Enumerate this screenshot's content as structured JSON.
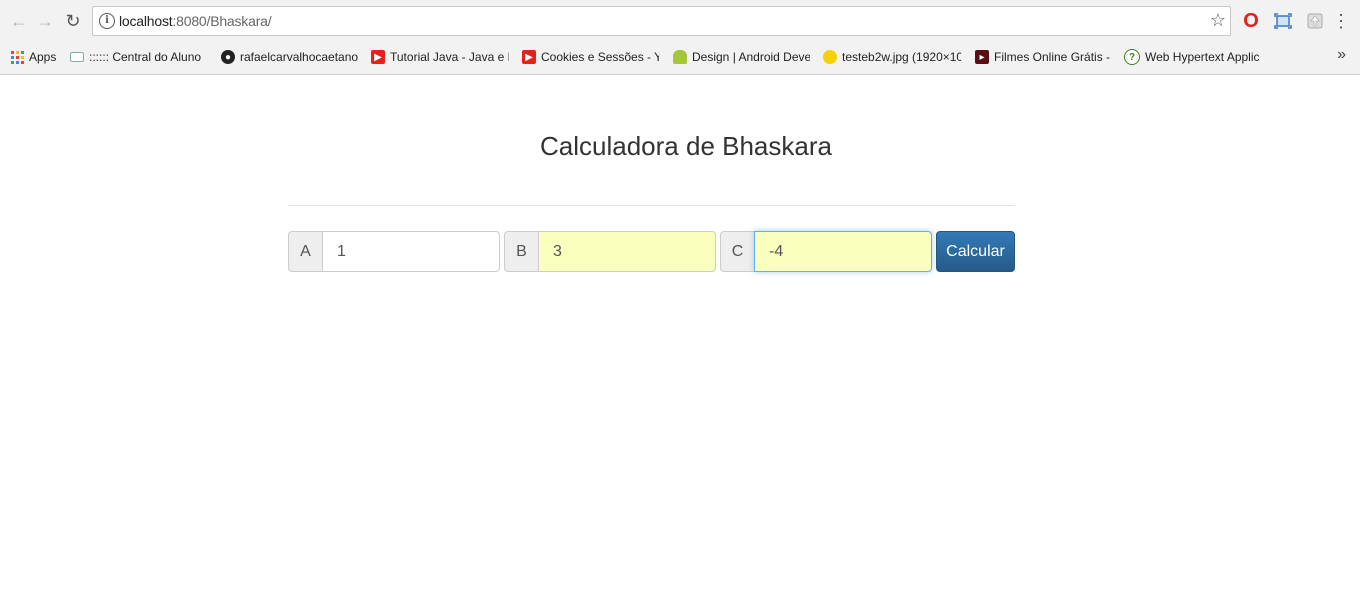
{
  "browser": {
    "url_host": "localhost",
    "url_path": ":8080/Bhaskara/",
    "bookmarks": [
      {
        "label": "Apps",
        "icon": "apps-grid-icon"
      },
      {
        "label": ":::::: Central do Aluno",
        "icon": "central-aluno-icon"
      },
      {
        "label": "rafaelcarvalhocaetano",
        "icon": "github-icon"
      },
      {
        "label": "Tutorial Java - Java e E",
        "icon": "youtube-icon"
      },
      {
        "label": "Cookies e Sessões - Yo",
        "icon": "youtube-icon"
      },
      {
        "label": "Design | Android Deve",
        "icon": "android-icon"
      },
      {
        "label": "testeb2w.jpg (1920×10",
        "icon": "image-icon"
      },
      {
        "label": "Filmes Online Grátis -",
        "icon": "film-icon"
      },
      {
        "label": "Web Hypertext Applic",
        "icon": "whatwg-icon"
      }
    ],
    "more_label": "»"
  },
  "page": {
    "title": "Calculadora de Bhaskara",
    "fields": [
      {
        "label": "A",
        "value": "1"
      },
      {
        "label": "B",
        "value": "3"
      },
      {
        "label": "C",
        "value": "-4"
      }
    ],
    "button": "Calcular"
  },
  "colors": {
    "button": "#286090",
    "autofill": "#faffbd",
    "focus": "#66afe9"
  }
}
